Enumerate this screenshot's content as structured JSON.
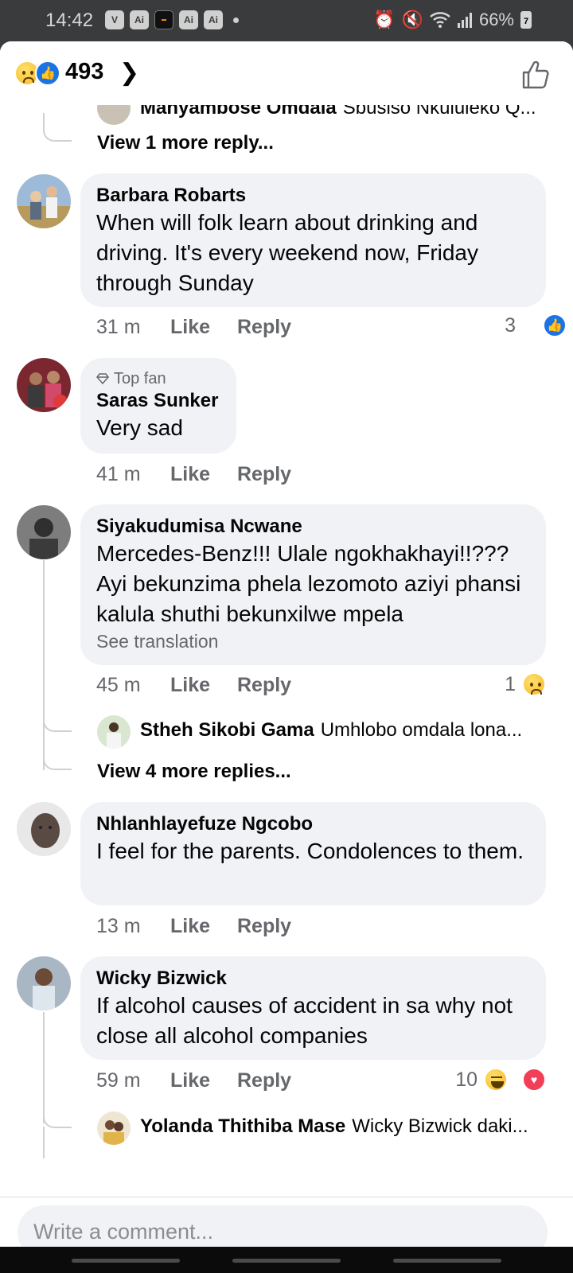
{
  "status_bar": {
    "time": "14:42",
    "app_icons": [
      "V",
      "Ai",
      "",
      "Ai",
      "Ai"
    ],
    "battery": "66%",
    "battery_badge": "7"
  },
  "reaction_bar": {
    "count": "493",
    "icons": [
      "sad-reaction-icon",
      "like-reaction-icon"
    ]
  },
  "partial_reply": {
    "name": "Manyambose Omdala",
    "text": "Sbusiso Nkululeko Q..."
  },
  "comments": [
    {
      "name": "Barbara Robarts",
      "text": "When will folk learn about drinking and driving. It's every weekend now, Friday through Sunday",
      "time": "31 m",
      "like": "Like",
      "reply": "Reply",
      "reactions": "3"
    },
    {
      "badge": "Top fan",
      "name": "Saras Sunker",
      "text": "Very sad",
      "time": "41 m",
      "like": "Like",
      "reply": "Reply"
    },
    {
      "name": "Siyakudumisa Ncwane",
      "text": "Mercedes-Benz!!! Ulale ngokhakhayi!!??? Ayi bekunzima phela lezomoto aziyi phansi kalula shuthi bekunxilwe mpela",
      "translate": "See translation",
      "time": "45 m",
      "like": "Like",
      "reply": "Reply",
      "reactions": "1",
      "reply_preview": {
        "name": "Stheh Sikobi Gama",
        "text": "Umhlobo omdala lona..."
      },
      "view_more": "View 4 more replies..."
    },
    {
      "name": "Nhlanhlayefuze Ngcobo",
      "text": "I feel for the parents. Condolences to them.",
      "time": "13 m",
      "like": "Like",
      "reply": "Reply"
    },
    {
      "name": "Wicky Bizwick",
      "text": "If alcohol causes of accident in sa why not close all alcohol companies",
      "time": "59 m",
      "like": "Like",
      "reply": "Reply",
      "reactions": "10",
      "reply_preview": {
        "name": "Yolanda Thithiba Mase",
        "text": "Wicky Bizwick daki..."
      }
    }
  ],
  "view_more_top": "View 1 more reply...",
  "composer": {
    "placeholder": "Write a comment..."
  }
}
